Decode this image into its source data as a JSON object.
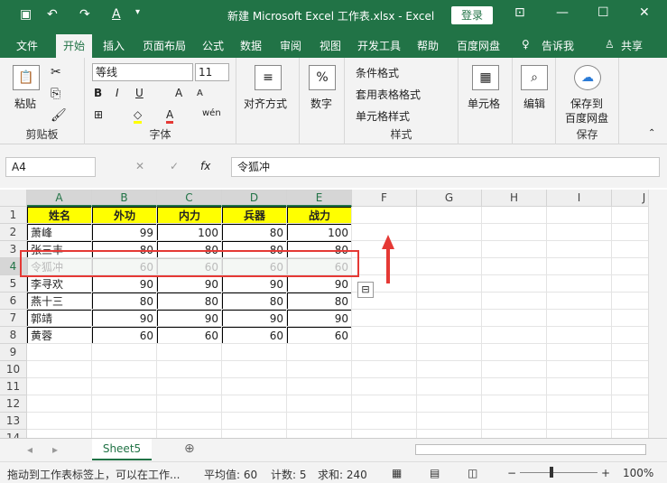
{
  "titlebar": {
    "title": "新建 Microsoft Excel 工作表.xlsx  -  Excel",
    "login": "登录"
  },
  "tabs": [
    "文件",
    "开始",
    "插入",
    "页面布局",
    "公式",
    "数据",
    "审阅",
    "视图",
    "开发工具",
    "帮助",
    "百度网盘",
    "告诉我",
    "共享"
  ],
  "ribbon": {
    "clipboard": {
      "paste": "粘贴",
      "label": "剪贴板"
    },
    "font": {
      "name": "等线",
      "size": "11",
      "bold": "B",
      "italic": "I",
      "underline": "U",
      "grow": "A",
      "shrink": "A",
      "label": "字体"
    },
    "align": {
      "label": "对齐方式"
    },
    "number": {
      "label": "数字",
      "icon": "%"
    },
    "styles": {
      "cond": "条件格式",
      "table": "套用表格格式",
      "cell": "单元格样式",
      "label": "样式"
    },
    "cells": {
      "label": "单元格"
    },
    "edit": {
      "label": "编辑"
    },
    "save": {
      "line1": "保存到",
      "line2": "百度网盘",
      "label": "保存"
    }
  },
  "formula": {
    "namebox": "A4",
    "fx": "fx",
    "content": "令狐冲"
  },
  "columns": [
    "A",
    "B",
    "C",
    "D",
    "E",
    "F",
    "G",
    "H",
    "I",
    "J"
  ],
  "rows": [
    "1",
    "2",
    "3",
    "4",
    "5",
    "6",
    "7",
    "8",
    "9",
    "10",
    "11",
    "12",
    "13",
    "14"
  ],
  "table": {
    "headers": [
      "姓名",
      "外功",
      "内力",
      "兵器",
      "战力"
    ],
    "rows": [
      [
        "萧峰",
        "99",
        "100",
        "80",
        "100"
      ],
      [
        "张三丰",
        "80",
        "80",
        "80",
        "80"
      ],
      [
        "令狐冲",
        "60",
        "60",
        "60",
        "60"
      ],
      [
        "李寻欢",
        "90",
        "90",
        "90",
        "90"
      ],
      [
        "燕十三",
        "80",
        "80",
        "80",
        "80"
      ],
      [
        "郭靖",
        "90",
        "90",
        "90",
        "90"
      ],
      [
        "黄蓉",
        "60",
        "60",
        "60",
        "60"
      ]
    ]
  },
  "sheet": {
    "name": "Sheet5"
  },
  "status": {
    "msg": "拖动到工作表标签上，可以在工作...",
    "avg": "平均值: 60",
    "count": "计数: 5",
    "sum": "求和: 240",
    "zoom": "100%"
  },
  "colors": {
    "accent": "#217346",
    "header_fill": "#ffff00",
    "highlight": "#e53935"
  }
}
